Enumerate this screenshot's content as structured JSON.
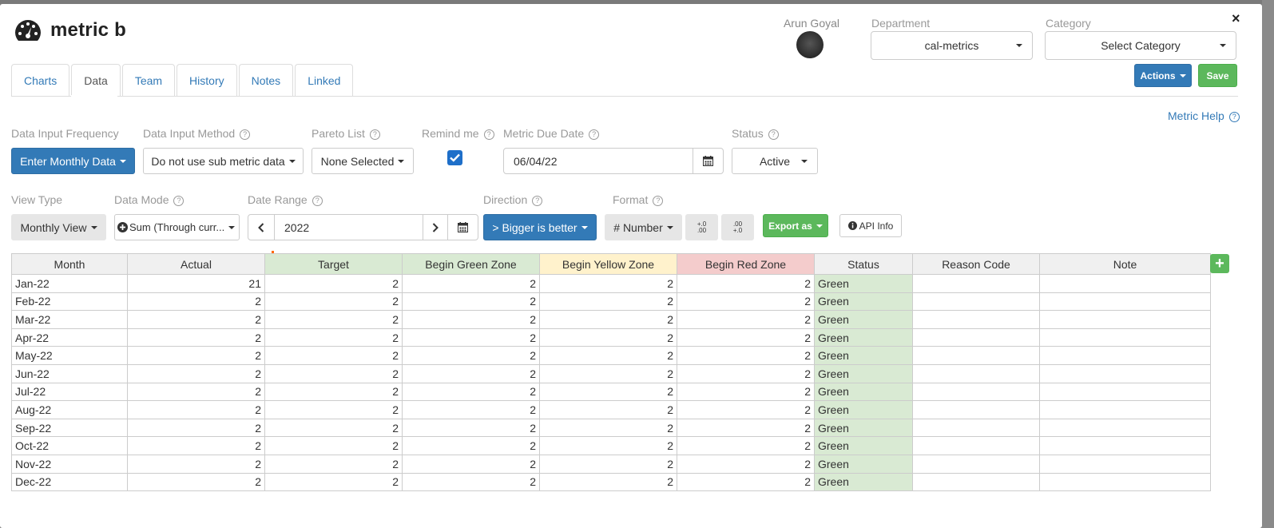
{
  "header": {
    "title": "metric b",
    "close": "×"
  },
  "owner": {
    "name": "Arun Goyal"
  },
  "department": {
    "label": "Department",
    "value": "cal-metrics"
  },
  "category": {
    "label": "Category",
    "value": "Select Category"
  },
  "buttons": {
    "actions": "Actions",
    "save": "Save",
    "export": "Export as",
    "api_info": "API Info",
    "add_row": "+"
  },
  "tabs": [
    {
      "label": "Charts"
    },
    {
      "label": "Data",
      "active": true
    },
    {
      "label": "Team"
    },
    {
      "label": "History"
    },
    {
      "label": "Notes"
    },
    {
      "label": "Linked"
    }
  ],
  "metric_help": "Metric Help",
  "row1": {
    "frequency": {
      "label": "Data Input Frequency",
      "value": "Enter Monthly Data"
    },
    "method": {
      "label": "Data Input Method",
      "value": "Do not use sub metric data"
    },
    "pareto": {
      "label": "Pareto List",
      "value": "None Selected"
    },
    "remind": {
      "label": "Remind me",
      "checked": true
    },
    "due_date": {
      "label": "Metric Due Date",
      "value": "06/04/22"
    },
    "status": {
      "label": "Status",
      "value": "Active"
    }
  },
  "row2": {
    "view_type": {
      "label": "View Type",
      "value": "Monthly View"
    },
    "data_mode": {
      "label": "Data Mode",
      "value": "Sum (Through curr..."
    },
    "date_range": {
      "label": "Date Range",
      "value": "2022"
    },
    "direction": {
      "label": "Direction",
      "value": "> Bigger is better"
    },
    "format": {
      "label": "Format",
      "value": "# Number"
    },
    "decimal_add": "+.0\n.00",
    "decimal_remove": ".00\n+.0"
  },
  "grid": {
    "columns": [
      "Month",
      "Actual",
      "Target",
      "Begin Green Zone",
      "Begin Yellow Zone",
      "Begin Red Zone",
      "Status",
      "Reason Code",
      "Note"
    ],
    "rows": [
      [
        "Jan-22",
        "21",
        "2",
        "2",
        "2",
        "2",
        "Green",
        "",
        ""
      ],
      [
        "Feb-22",
        "2",
        "2",
        "2",
        "2",
        "2",
        "Green",
        "",
        ""
      ],
      [
        "Mar-22",
        "2",
        "2",
        "2",
        "2",
        "2",
        "Green",
        "",
        ""
      ],
      [
        "Apr-22",
        "2",
        "2",
        "2",
        "2",
        "2",
        "Green",
        "",
        ""
      ],
      [
        "May-22",
        "2",
        "2",
        "2",
        "2",
        "2",
        "Green",
        "",
        ""
      ],
      [
        "Jun-22",
        "2",
        "2",
        "2",
        "2",
        "2",
        "Green",
        "",
        ""
      ],
      [
        "Jul-22",
        "2",
        "2",
        "2",
        "2",
        "2",
        "Green",
        "",
        ""
      ],
      [
        "Aug-22",
        "2",
        "2",
        "2",
        "2",
        "2",
        "Green",
        "",
        ""
      ],
      [
        "Sep-22",
        "2",
        "2",
        "2",
        "2",
        "2",
        "Green",
        "",
        ""
      ],
      [
        "Oct-22",
        "2",
        "2",
        "2",
        "2",
        "2",
        "Green",
        "",
        ""
      ],
      [
        "Nov-22",
        "2",
        "2",
        "2",
        "2",
        "2",
        "Green",
        "",
        ""
      ],
      [
        "Dec-22",
        "2",
        "2",
        "2",
        "2",
        "2",
        "Green",
        "",
        ""
      ]
    ]
  },
  "colors": {
    "primary": "#337ab7",
    "success": "#5cb85c",
    "green_zone": "#d9ead3",
    "yellow_zone": "#fff2cc",
    "red_zone": "#f4cccc"
  }
}
